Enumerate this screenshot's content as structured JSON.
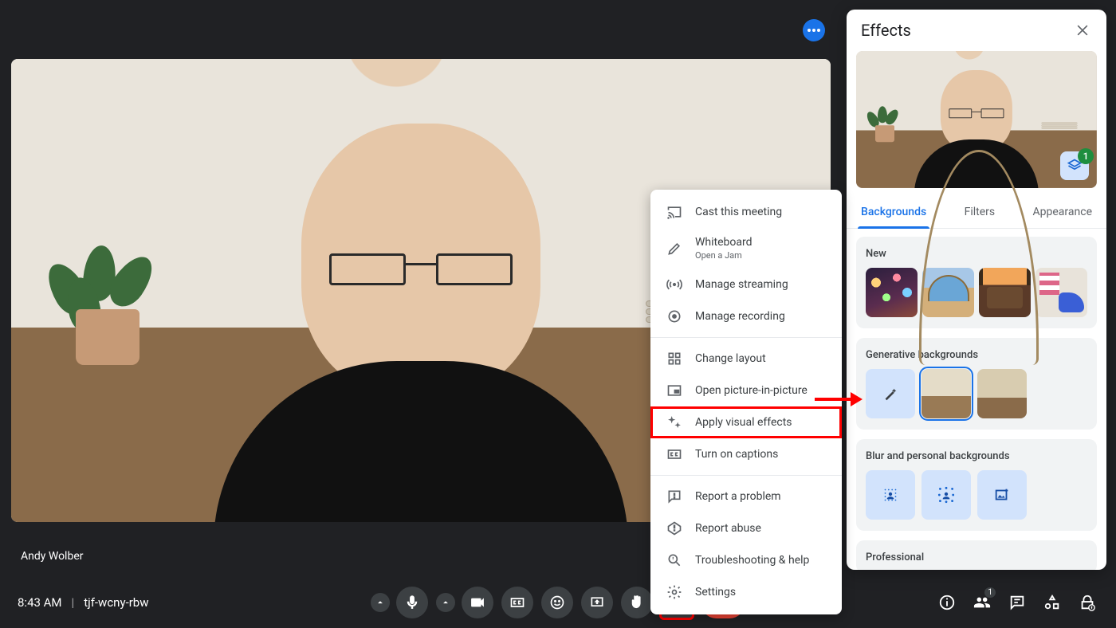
{
  "meeting": {
    "participant_name": "Andy Wolber",
    "time": "8:43 AM",
    "code": "tjf-wcny-rbw"
  },
  "participant_count": "1",
  "effects_layer_count": "1",
  "menu": {
    "cast": "Cast this meeting",
    "whiteboard": "Whiteboard",
    "whiteboard_sub": "Open a Jam",
    "streaming": "Manage streaming",
    "recording": "Manage recording",
    "layout": "Change layout",
    "pip": "Open picture-in-picture",
    "visual_effects": "Apply visual effects",
    "captions": "Turn on captions",
    "report_problem": "Report a problem",
    "report_abuse": "Report abuse",
    "troubleshoot": "Troubleshooting & help",
    "settings": "Settings"
  },
  "effects": {
    "title": "Effects",
    "tabs": {
      "backgrounds": "Backgrounds",
      "filters": "Filters",
      "appearance": "Appearance"
    },
    "sections": {
      "new": "New",
      "generative": "Generative backgrounds",
      "blur": "Blur and personal backgrounds",
      "professional": "Professional"
    }
  }
}
